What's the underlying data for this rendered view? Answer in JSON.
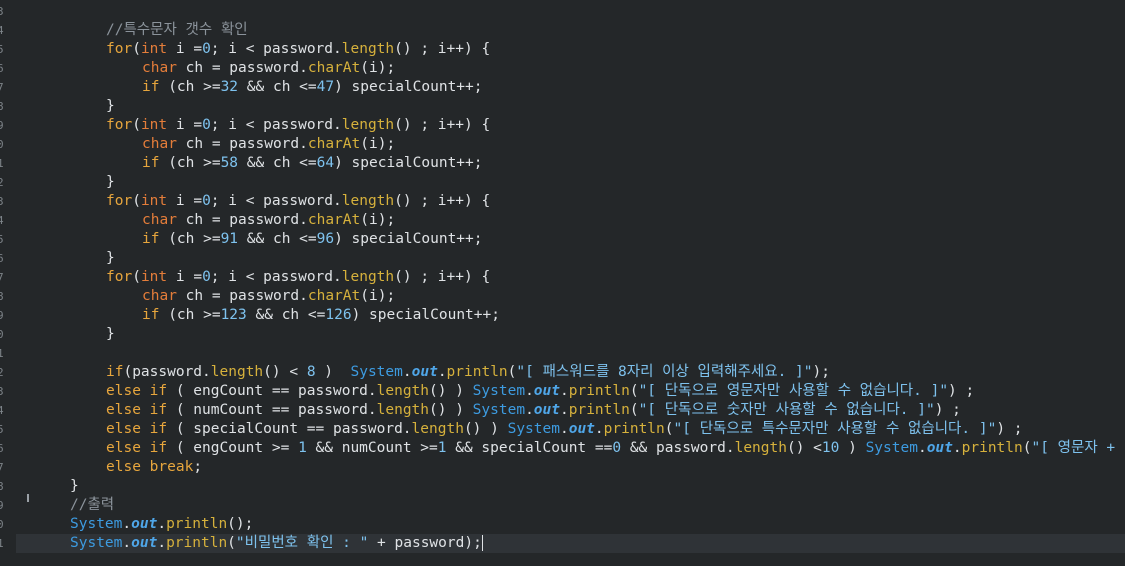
{
  "editor": {
    "line_numbers": [
      "3",
      "4",
      "5",
      "6",
      "7",
      "8",
      "9",
      "0",
      "1",
      "2",
      "3",
      "4",
      "5",
      "6",
      "7",
      "8",
      "9",
      "0",
      "1",
      "2",
      "3",
      "4",
      "5",
      "6",
      "7",
      "8",
      "9",
      "0",
      "1"
    ],
    "lines": [
      {
        "indent": 20,
        "tokens": []
      },
      {
        "indent": 20,
        "tokens": [
          {
            "c": "cm",
            "t": "//특수문자 갯수 확인"
          }
        ]
      },
      {
        "indent": 20,
        "tokens": [
          {
            "c": "kw",
            "t": "for"
          },
          {
            "c": "var",
            "t": "("
          },
          {
            "c": "ty",
            "t": "int"
          },
          {
            "c": "var",
            "t": " i ="
          },
          {
            "c": "num",
            "t": "0"
          },
          {
            "c": "var",
            "t": "; i < password."
          },
          {
            "c": "fn",
            "t": "length"
          },
          {
            "c": "var",
            "t": "() ; i++) {"
          }
        ]
      },
      {
        "indent": 28,
        "tokens": [
          {
            "c": "ty",
            "t": "char"
          },
          {
            "c": "var",
            "t": " ch = password."
          },
          {
            "c": "fn",
            "t": "charAt"
          },
          {
            "c": "var",
            "t": "(i);"
          }
        ]
      },
      {
        "indent": 28,
        "tokens": [
          {
            "c": "kw",
            "t": "if"
          },
          {
            "c": "var",
            "t": " (ch >="
          },
          {
            "c": "num",
            "t": "32"
          },
          {
            "c": "var",
            "t": " && ch <="
          },
          {
            "c": "num",
            "t": "47"
          },
          {
            "c": "var",
            "t": ") specialCount++;"
          }
        ]
      },
      {
        "indent": 20,
        "tokens": [
          {
            "c": "var",
            "t": "}"
          }
        ]
      },
      {
        "indent": 20,
        "tokens": [
          {
            "c": "kw",
            "t": "for"
          },
          {
            "c": "var",
            "t": "("
          },
          {
            "c": "ty",
            "t": "int"
          },
          {
            "c": "var",
            "t": " i ="
          },
          {
            "c": "num",
            "t": "0"
          },
          {
            "c": "var",
            "t": "; i < password."
          },
          {
            "c": "fn",
            "t": "length"
          },
          {
            "c": "var",
            "t": "() ; i++) {"
          }
        ]
      },
      {
        "indent": 28,
        "tokens": [
          {
            "c": "ty",
            "t": "char"
          },
          {
            "c": "var",
            "t": " ch = password."
          },
          {
            "c": "fn",
            "t": "charAt"
          },
          {
            "c": "var",
            "t": "(i);"
          }
        ]
      },
      {
        "indent": 28,
        "tokens": [
          {
            "c": "kw",
            "t": "if"
          },
          {
            "c": "var",
            "t": " (ch >="
          },
          {
            "c": "num",
            "t": "58"
          },
          {
            "c": "var",
            "t": " && ch <="
          },
          {
            "c": "num",
            "t": "64"
          },
          {
            "c": "var",
            "t": ") specialCount++;"
          }
        ]
      },
      {
        "indent": 20,
        "tokens": [
          {
            "c": "var",
            "t": "}"
          }
        ]
      },
      {
        "indent": 20,
        "tokens": [
          {
            "c": "kw",
            "t": "for"
          },
          {
            "c": "var",
            "t": "("
          },
          {
            "c": "ty",
            "t": "int"
          },
          {
            "c": "var",
            "t": " i ="
          },
          {
            "c": "num",
            "t": "0"
          },
          {
            "c": "var",
            "t": "; i < password."
          },
          {
            "c": "fn",
            "t": "length"
          },
          {
            "c": "var",
            "t": "() ; i++) {"
          }
        ]
      },
      {
        "indent": 28,
        "tokens": [
          {
            "c": "ty",
            "t": "char"
          },
          {
            "c": "var",
            "t": " ch = password."
          },
          {
            "c": "fn",
            "t": "charAt"
          },
          {
            "c": "var",
            "t": "(i);"
          }
        ]
      },
      {
        "indent": 28,
        "tokens": [
          {
            "c": "kw",
            "t": "if"
          },
          {
            "c": "var",
            "t": " (ch >="
          },
          {
            "c": "num",
            "t": "91"
          },
          {
            "c": "var",
            "t": " && ch <="
          },
          {
            "c": "num",
            "t": "96"
          },
          {
            "c": "var",
            "t": ") specialCount++;"
          }
        ]
      },
      {
        "indent": 20,
        "tokens": [
          {
            "c": "var",
            "t": "}"
          }
        ]
      },
      {
        "indent": 20,
        "tokens": [
          {
            "c": "kw",
            "t": "for"
          },
          {
            "c": "var",
            "t": "("
          },
          {
            "c": "ty",
            "t": "int"
          },
          {
            "c": "var",
            "t": " i ="
          },
          {
            "c": "num",
            "t": "0"
          },
          {
            "c": "var",
            "t": "; i < password."
          },
          {
            "c": "fn",
            "t": "length"
          },
          {
            "c": "var",
            "t": "() ; i++) {"
          }
        ]
      },
      {
        "indent": 28,
        "tokens": [
          {
            "c": "ty",
            "t": "char"
          },
          {
            "c": "var",
            "t": " ch = password."
          },
          {
            "c": "fn",
            "t": "charAt"
          },
          {
            "c": "var",
            "t": "(i);"
          }
        ]
      },
      {
        "indent": 28,
        "tokens": [
          {
            "c": "kw",
            "t": "if"
          },
          {
            "c": "var",
            "t": " (ch >="
          },
          {
            "c": "num",
            "t": "123"
          },
          {
            "c": "var",
            "t": " && ch <="
          },
          {
            "c": "num",
            "t": "126"
          },
          {
            "c": "var",
            "t": ") specialCount++;"
          }
        ]
      },
      {
        "indent": 20,
        "tokens": [
          {
            "c": "var",
            "t": "}"
          }
        ]
      },
      {
        "indent": 20,
        "tokens": []
      },
      {
        "indent": 20,
        "tokens": [
          {
            "c": "kw",
            "t": "if"
          },
          {
            "c": "var",
            "t": "(password."
          },
          {
            "c": "fn",
            "t": "length"
          },
          {
            "c": "var",
            "t": "() < "
          },
          {
            "c": "num",
            "t": "8"
          },
          {
            "c": "var",
            "t": " )  "
          },
          {
            "c": "sys",
            "t": "System"
          },
          {
            "c": "var",
            "t": "."
          },
          {
            "c": "out",
            "t": "out"
          },
          {
            "c": "var",
            "t": "."
          },
          {
            "c": "fn",
            "t": "println"
          },
          {
            "c": "var",
            "t": "("
          },
          {
            "c": "str",
            "t": "\"[ 패스워드를 8자리 이상 입력해주세요. ]\""
          },
          {
            "c": "var",
            "t": ");"
          }
        ]
      },
      {
        "indent": 20,
        "tokens": [
          {
            "c": "kw",
            "t": "else if"
          },
          {
            "c": "var",
            "t": " ( engCount == password."
          },
          {
            "c": "fn",
            "t": "length"
          },
          {
            "c": "var",
            "t": "() ) "
          },
          {
            "c": "sys",
            "t": "System"
          },
          {
            "c": "var",
            "t": "."
          },
          {
            "c": "out",
            "t": "out"
          },
          {
            "c": "var",
            "t": "."
          },
          {
            "c": "fn",
            "t": "println"
          },
          {
            "c": "var",
            "t": "("
          },
          {
            "c": "str",
            "t": "\"[ 단독으로 영문자만 사용할 수 없습니다. ]\""
          },
          {
            "c": "var",
            "t": ") ;"
          }
        ]
      },
      {
        "indent": 20,
        "tokens": [
          {
            "c": "kw",
            "t": "else if"
          },
          {
            "c": "var",
            "t": " ( numCount == password."
          },
          {
            "c": "fn",
            "t": "length"
          },
          {
            "c": "var",
            "t": "() ) "
          },
          {
            "c": "sys",
            "t": "System"
          },
          {
            "c": "var",
            "t": "."
          },
          {
            "c": "out",
            "t": "out"
          },
          {
            "c": "var",
            "t": "."
          },
          {
            "c": "fn",
            "t": "println"
          },
          {
            "c": "var",
            "t": "("
          },
          {
            "c": "str",
            "t": "\"[ 단독으로 숫자만 사용할 수 없습니다. ]\""
          },
          {
            "c": "var",
            "t": ") ;"
          }
        ]
      },
      {
        "indent": 20,
        "tokens": [
          {
            "c": "kw",
            "t": "else if"
          },
          {
            "c": "var",
            "t": " ( specialCount == password."
          },
          {
            "c": "fn",
            "t": "length"
          },
          {
            "c": "var",
            "t": "() ) "
          },
          {
            "c": "sys",
            "t": "System"
          },
          {
            "c": "var",
            "t": "."
          },
          {
            "c": "out",
            "t": "out"
          },
          {
            "c": "var",
            "t": "."
          },
          {
            "c": "fn",
            "t": "println"
          },
          {
            "c": "var",
            "t": "("
          },
          {
            "c": "str",
            "t": "\"[ 단독으로 특수문자만 사용할 수 없습니다. ]\""
          },
          {
            "c": "var",
            "t": ") ;"
          }
        ]
      },
      {
        "indent": 20,
        "tokens": [
          {
            "c": "kw",
            "t": "else if"
          },
          {
            "c": "var",
            "t": " ( engCount >= "
          },
          {
            "c": "num",
            "t": "1"
          },
          {
            "c": "var",
            "t": " && numCount >="
          },
          {
            "c": "num",
            "t": "1"
          },
          {
            "c": "var",
            "t": " && specialCount =="
          },
          {
            "c": "num",
            "t": "0"
          },
          {
            "c": "var",
            "t": " && password."
          },
          {
            "c": "fn",
            "t": "length"
          },
          {
            "c": "var",
            "t": "() <"
          },
          {
            "c": "num",
            "t": "10"
          },
          {
            "c": "var",
            "t": " ) "
          },
          {
            "c": "sys",
            "t": "System"
          },
          {
            "c": "var",
            "t": "."
          },
          {
            "c": "out",
            "t": "out"
          },
          {
            "c": "var",
            "t": "."
          },
          {
            "c": "fn",
            "t": "println"
          },
          {
            "c": "var",
            "t": "("
          },
          {
            "c": "str",
            "t": "\"[ 영문자 +"
          }
        ]
      },
      {
        "indent": 20,
        "tokens": [
          {
            "c": "kw",
            "t": "else break"
          },
          {
            "c": "var",
            "t": ";"
          }
        ]
      },
      {
        "indent": 12,
        "tokens": [
          {
            "c": "var",
            "t": "}"
          }
        ]
      },
      {
        "indent": 12,
        "tokens": [
          {
            "c": "cm",
            "t": "//출력"
          }
        ]
      },
      {
        "indent": 12,
        "tokens": [
          {
            "c": "sys",
            "t": "System"
          },
          {
            "c": "var",
            "t": "."
          },
          {
            "c": "out",
            "t": "out"
          },
          {
            "c": "var",
            "t": "."
          },
          {
            "c": "fn",
            "t": "println"
          },
          {
            "c": "var",
            "t": "();"
          }
        ]
      },
      {
        "indent": 12,
        "current": true,
        "caret": true,
        "tokens": [
          {
            "c": "sys",
            "t": "System"
          },
          {
            "c": "var",
            "t": "."
          },
          {
            "c": "out",
            "t": "out"
          },
          {
            "c": "var",
            "t": "."
          },
          {
            "c": "fn",
            "t": "println"
          },
          {
            "c": "var",
            "t": "("
          },
          {
            "c": "str",
            "t": "\"비밀번호 확인 : \""
          },
          {
            "c": "var",
            "t": " + password);"
          }
        ]
      }
    ]
  }
}
